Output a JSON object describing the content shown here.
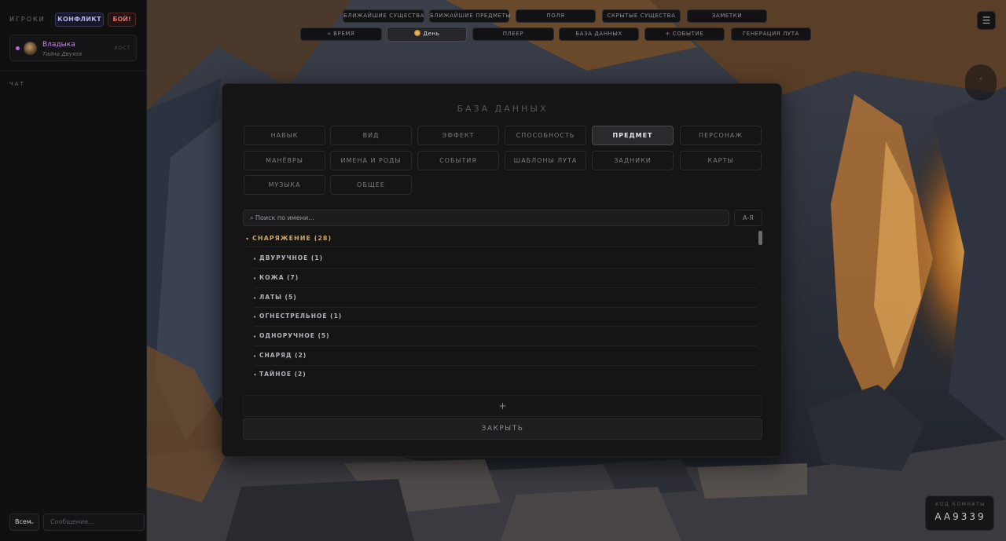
{
  "sidebar": {
    "players_title": "ИГРОКИ",
    "conflict_label": "КОНФЛИКТ",
    "fight_label": "БОЙ!",
    "player": {
      "name": "Владыка",
      "subtitle": "Тайна Двуязя",
      "role": "ХОСТ"
    },
    "chat_title": "ЧАТ",
    "chat_target": "Всем",
    "message_placeholder": "Сообщение..."
  },
  "toolbar": {
    "row1": [
      "БЛИЖАЙШИЕ СУЩЕСТВА",
      "БЛИЖАЙШИЕ ПРЕДМЕТЫ",
      "ПОЛЯ",
      "СКРЫТЫЕ СУЩЕСТВА",
      "ЗАМЕТКИ"
    ],
    "row2": [
      "« ВРЕМЯ",
      "День",
      "ПЛЕЕР",
      "БАЗА ДАННЫХ",
      "+ СОБЫТИЕ",
      "ГЕНЕРАЦИЯ ЛУТА"
    ],
    "menu_icon": "☰",
    "side_icon": "⚡"
  },
  "modal": {
    "title": "БАЗА ДАННЫХ",
    "tabs": [
      "НАВЫК",
      "ВИД",
      "ЭФФЕКТ",
      "СПОСОБНОСТЬ",
      "ПРЕДМЕТ",
      "ПЕРСОНАЖ",
      "МАНЁВРЫ",
      "ИМЕНА И РОДЫ",
      "СОБЫТИЯ",
      "ШАБЛОНЫ ЛУТА",
      "ЗАДНИКИ",
      "КАРТЫ",
      "МУЗЫКА",
      "ОБЩЕЕ"
    ],
    "active_tab": "ПРЕДМЕТ",
    "search_placeholder": "⌕ Поиск по имени...",
    "sort_label": "А-Я",
    "category": "СНАРЯЖЕНИЕ (28)",
    "subcategories": [
      "ДВУРУЧНОЕ (1)",
      "КОЖА (7)",
      "ЛАТЫ (5)",
      "ОГНЕСТРЕЛЬНОЕ (1)",
      "ОДНОРУЧНОЕ (5)",
      "СНАРЯД (2)",
      "ТАЙНОЕ (2)"
    ],
    "add_label": "+",
    "close_label": "ЗАКРЫТЬ"
  },
  "room": {
    "label": "КОД КОМНАТЫ",
    "code": "AA9339"
  },
  "colors": {
    "accent_gold": "#d0a35c",
    "player_purple": "#c58be0",
    "fight_red": "#e06b6b",
    "conflict_blue": "#b7b2e6"
  }
}
